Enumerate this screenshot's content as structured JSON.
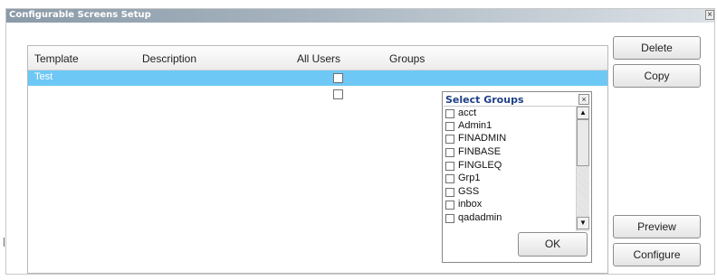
{
  "window": {
    "title": "Configurable Screens Setup",
    "close_glyph": "×"
  },
  "grid": {
    "columns": [
      "Template",
      "Description",
      "All Users",
      "Groups"
    ],
    "rows": [
      {
        "template": "Test",
        "description": "",
        "all_users": false,
        "groups": "",
        "selected": true
      },
      {
        "template": "",
        "description": "",
        "all_users": false,
        "groups": "",
        "selected": false
      }
    ]
  },
  "select_groups": {
    "title": "Select Groups",
    "close_glyph": "×",
    "items": [
      {
        "label": "acct",
        "checked": false
      },
      {
        "label": "Admin1",
        "checked": false
      },
      {
        "label": "FINADMIN",
        "checked": false
      },
      {
        "label": "FINBASE",
        "checked": false
      },
      {
        "label": "FINGLEQ",
        "checked": false
      },
      {
        "label": "Grp1",
        "checked": false
      },
      {
        "label": "GSS",
        "checked": false
      },
      {
        "label": "inbox",
        "checked": false
      },
      {
        "label": "qadadmin",
        "checked": false
      }
    ],
    "scroll_up_glyph": "▲",
    "scroll_down_glyph": "▼",
    "ok_label": "OK"
  },
  "buttons": {
    "delete": "Delete",
    "copy": "Copy",
    "preview": "Preview",
    "configure": "Configure"
  },
  "colors": {
    "selection": "#6ec8f5",
    "popup_title": "#1f3f86"
  }
}
